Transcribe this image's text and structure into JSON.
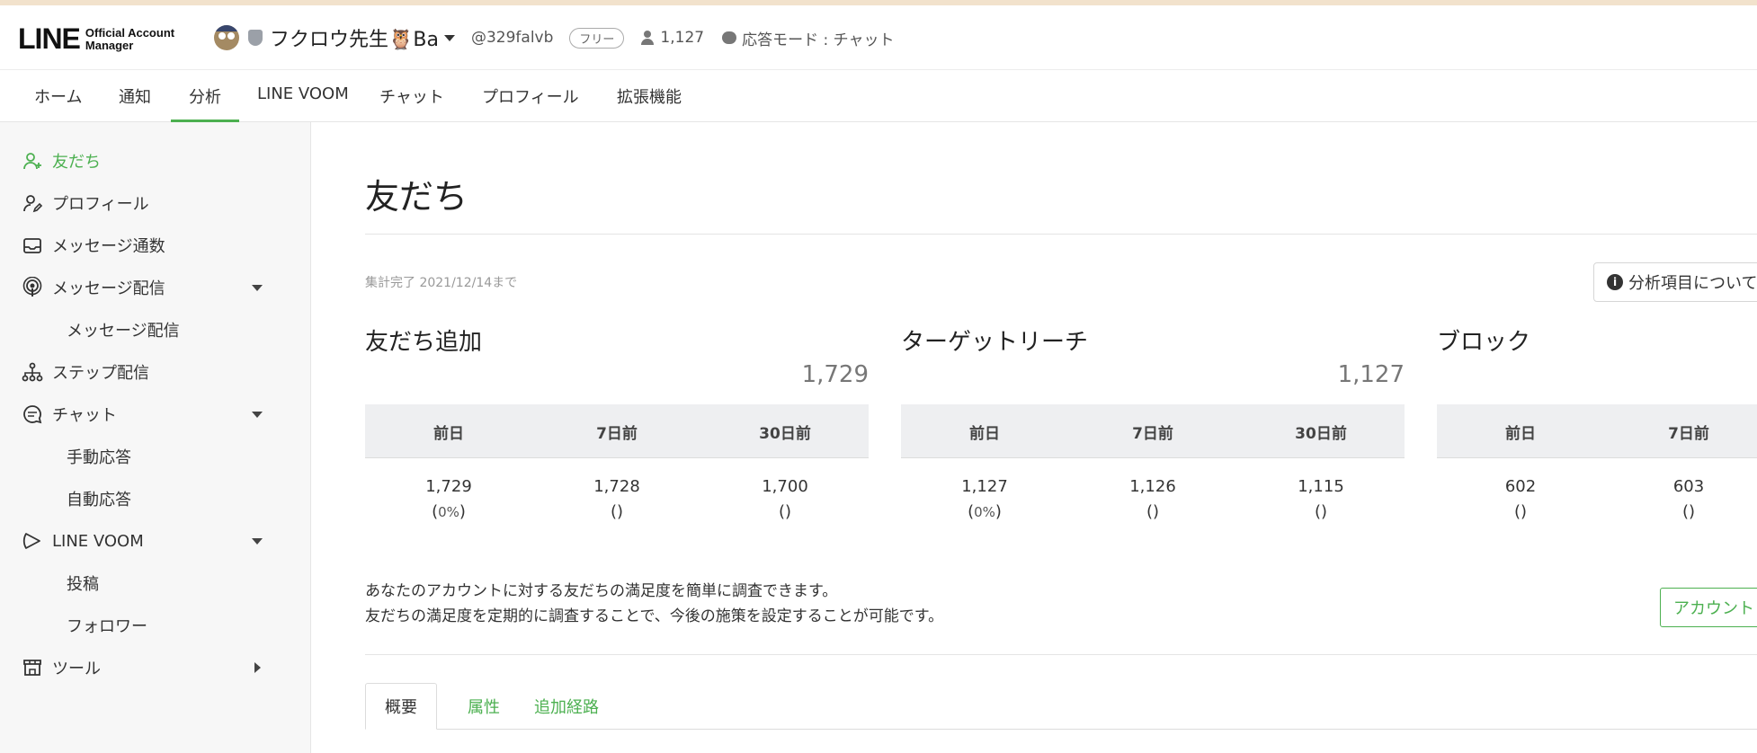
{
  "header": {
    "logo_main": "LINE",
    "logo_sub_1": "Official Account",
    "logo_sub_2": "Manager",
    "account_name": "フクロウ先生🦉Ba",
    "account_id": "@329falvb",
    "plan_badge": "フリー",
    "friends_count": "1,127",
    "response_mode": "応答モード : チャット"
  },
  "topnav": {
    "tabs": [
      {
        "label": "ホーム"
      },
      {
        "label": "通知"
      },
      {
        "label": "分析"
      },
      {
        "label": "LINE VOOM"
      },
      {
        "label": "チャット"
      },
      {
        "label": "プロフィール"
      },
      {
        "label": "拡張機能"
      }
    ],
    "active": "分析"
  },
  "sidebar": {
    "items": [
      {
        "label": "友だち",
        "icon": "friend-add-icon"
      },
      {
        "label": "プロフィール",
        "icon": "profile-edit-icon"
      },
      {
        "label": "メッセージ通数",
        "icon": "inbox-icon"
      },
      {
        "label": "メッセージ配信",
        "icon": "broadcast-icon"
      },
      {
        "label": "メッセージ配信"
      },
      {
        "label": "ステップ配信",
        "icon": "step-icon"
      },
      {
        "label": "チャット",
        "icon": "chat-bubble-icon"
      },
      {
        "label": "手動応答"
      },
      {
        "label": "自動応答"
      },
      {
        "label": "LINE VOOM",
        "icon": "voom-icon"
      },
      {
        "label": "投稿"
      },
      {
        "label": "フォロワー"
      },
      {
        "label": "ツール",
        "icon": "store-icon"
      }
    ]
  },
  "main": {
    "title": "友だち",
    "period": "集計完了 2021/12/14まで",
    "info_button": "分析項目について",
    "cards": [
      {
        "title": "友だち追加",
        "total": "1,729",
        "headers": [
          "前日",
          "7日前",
          "30日前"
        ],
        "values": [
          "1,729",
          "1,728",
          "1,700"
        ],
        "changes": [
          "0%",
          "",
          ""
        ]
      },
      {
        "title": "ターゲットリーチ",
        "total": "1,127",
        "headers": [
          "前日",
          "7日前",
          "30日前"
        ],
        "values": [
          "1,127",
          "1,126",
          "1,115"
        ],
        "changes": [
          "0%",
          "",
          ""
        ]
      },
      {
        "title": "ブロック",
        "total": "",
        "headers": [
          "前日",
          "7日前"
        ],
        "values": [
          "602",
          "603"
        ],
        "changes": [
          "",
          ""
        ]
      }
    ],
    "description_1": "あなたのアカウントに対する友だちの満足度を簡単に調査できます。",
    "description_2": "友だちの満足度を定期的に調査することで、今後の施策を設定することが可能です。",
    "survey_button": "アカウント",
    "subtabs": [
      "概要",
      "属性",
      "追加経路"
    ]
  },
  "colors": {
    "accent": "#4cb050",
    "sidebar_bg": "#f7f7f7",
    "table_header_bg": "#eeeff1"
  }
}
